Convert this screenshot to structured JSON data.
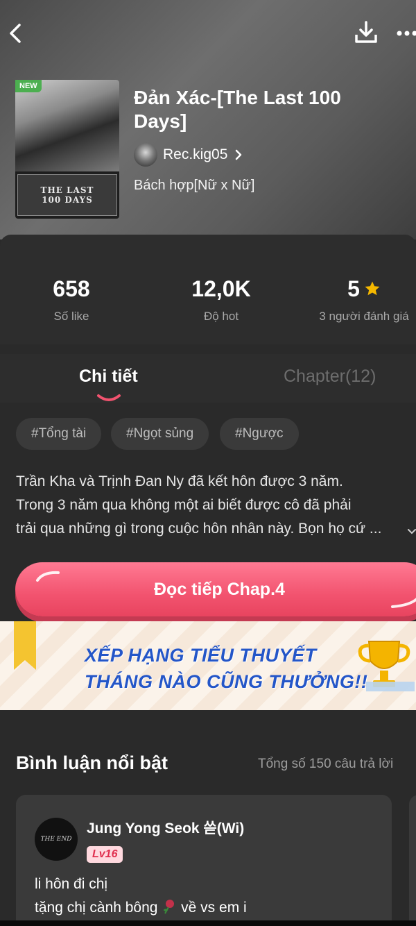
{
  "header": {
    "back_icon": "chevron-left-icon",
    "download_icon": "download-icon",
    "more_icon": "more-horizontal-icon"
  },
  "book": {
    "badge": "NEW",
    "cover_title": "THE LAST 100 DAYS",
    "title": "Đản Xác-[The Last 100 Days]",
    "author": "Rec.kig05",
    "genre": "Bách hợp[Nữ x Nữ]"
  },
  "stats": {
    "likes_value": "658",
    "likes_label": "Số like",
    "hot_value": "12,0K",
    "hot_label": "Độ hot",
    "rating_value": "5",
    "rating_label": "3 người đánh giá",
    "star_color": "#f5b800"
  },
  "tabs": {
    "detail": "Chi tiết",
    "chapter": "Chapter(12)"
  },
  "tags": [
    "#Tổng tài",
    "#Ngọt sủng",
    "#Ngược"
  ],
  "description": {
    "line1": "Trần Kha và Trịnh Đan Ny đã kết hôn được 3 năm.",
    "line2": "Trong 3 năm qua không một ai biết được cô đã phải",
    "line3": "trải qua những gì trong cuộc hôn nhân này. Bọn họ cứ ..."
  },
  "read_button": {
    "label": "Đọc tiếp Chap.4",
    "color": "#f2536f"
  },
  "banner": {
    "line1": "XẾP HẠNG TIỂU THUYẾT",
    "line2": "THÁNG NÀO CŨNG THƯỞNG!!",
    "text_color": "#2456c8"
  },
  "comments": {
    "title": "Bình luận nổi bật",
    "count": "Tổng số 150 câu trả lời",
    "items": [
      {
        "avatar_text": "THE END",
        "user": "Jung Yong Seok 쓷(Wi)",
        "level": "Lv16",
        "line1": "li hôn đi chị",
        "line2_a": "tặng chị cành bông",
        "line2_b": "về vs em i"
      }
    ]
  }
}
